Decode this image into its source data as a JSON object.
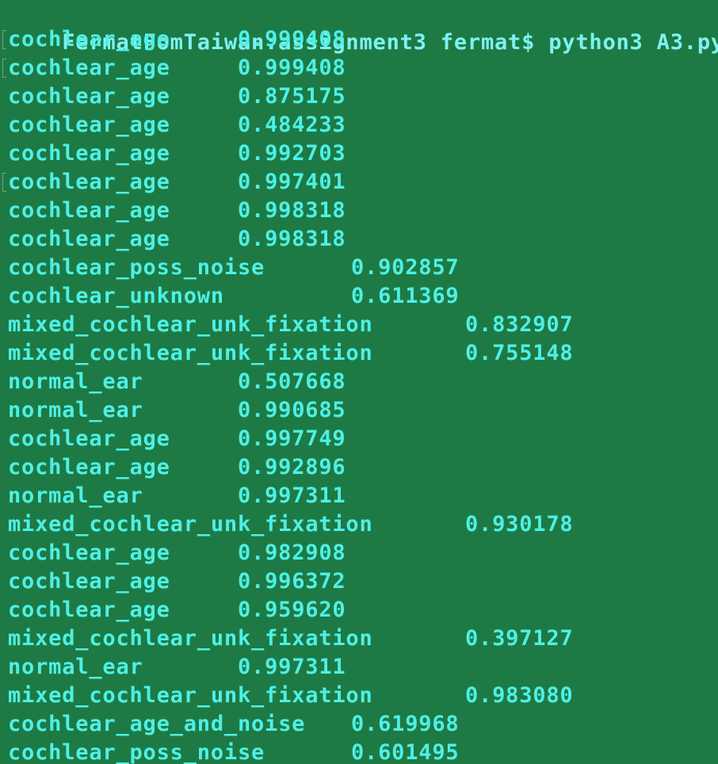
{
  "terminal": {
    "background_color": "#1e7a44",
    "text_color": "#4ef0e6",
    "prompt": "FermatFomTaiwan:assignment3 fermat$ python3 A3.py",
    "lines": [
      {
        "label": "cochlear_age",
        "value": "0.999408",
        "marked": true
      },
      {
        "label": "cochlear_age",
        "value": "0.999408",
        "marked": true
      },
      {
        "label": "cochlear_age",
        "value": "0.875175",
        "marked": false
      },
      {
        "label": "cochlear_age",
        "value": "0.484233",
        "marked": false
      },
      {
        "label": "cochlear_age",
        "value": "0.992703",
        "marked": false
      },
      {
        "label": "cochlear_age",
        "value": "0.997401",
        "marked": true
      },
      {
        "label": "cochlear_age",
        "value": "0.998318",
        "marked": false
      },
      {
        "label": "cochlear_age",
        "value": "0.998318",
        "marked": false
      },
      {
        "label": "cochlear_poss_noise",
        "value": "0.902857",
        "marked": false
      },
      {
        "label": "cochlear_unknown",
        "value": "0.611369",
        "marked": false
      },
      {
        "label": "mixed_cochlear_unk_fixation",
        "value": "0.832907",
        "marked": false
      },
      {
        "label": "mixed_cochlear_unk_fixation",
        "value": "0.755148",
        "marked": false
      },
      {
        "label": "normal_ear",
        "value": "0.507668",
        "marked": false
      },
      {
        "label": "normal_ear",
        "value": "0.990685",
        "marked": false
      },
      {
        "label": "cochlear_age",
        "value": "0.997749",
        "marked": false
      },
      {
        "label": "cochlear_age",
        "value": "0.992896",
        "marked": false
      },
      {
        "label": "normal_ear",
        "value": "0.997311",
        "marked": false
      },
      {
        "label": "mixed_cochlear_unk_fixation",
        "value": "0.930178",
        "marked": false
      },
      {
        "label": "cochlear_age",
        "value": "0.982908",
        "marked": false
      },
      {
        "label": "cochlear_age",
        "value": "0.996372",
        "marked": false
      },
      {
        "label": "cochlear_age",
        "value": "0.959620",
        "marked": false
      },
      {
        "label": "mixed_cochlear_unk_fixation",
        "value": "0.397127",
        "marked": false
      },
      {
        "label": "normal_ear",
        "value": "0.997311",
        "marked": false
      },
      {
        "label": "mixed_cochlear_unk_fixation",
        "value": "0.983080",
        "marked": false
      },
      {
        "label": "cochlear_age_and_noise",
        "value": "0.619968",
        "marked": false
      },
      {
        "label": "cochlear_poss_noise",
        "value": "0.601495",
        "marked": false
      }
    ]
  }
}
